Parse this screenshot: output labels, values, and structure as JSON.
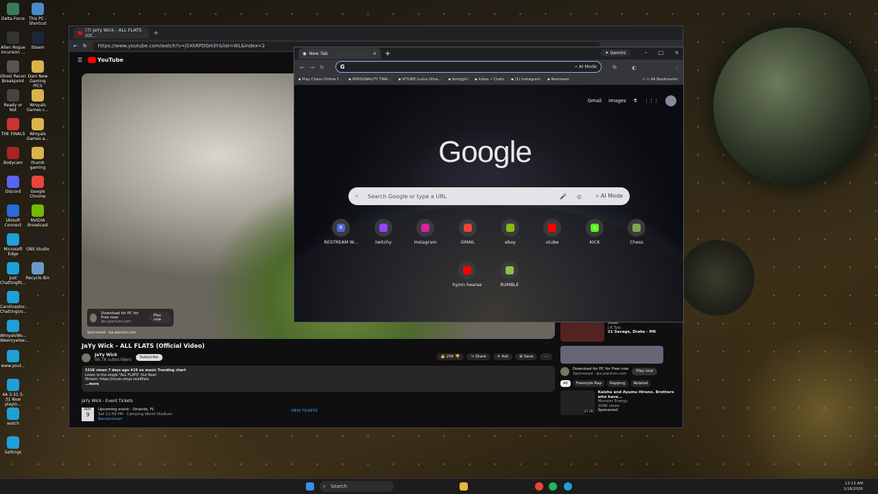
{
  "desktop": {
    "icons": [
      {
        "label": "Delta Force",
        "color": "#3a7a5a"
      },
      {
        "label": "This PC - Shortcut",
        "color": "#4a8ac8"
      },
      {
        "label": "Allen Rogue Incursion ...",
        "color": "#333"
      },
      {
        "label": "Steam",
        "color": "#1b2838"
      },
      {
        "label": "Ghost Recon Breakpoint",
        "color": "#555"
      },
      {
        "label": "Dani New Gaming PICS",
        "color": "#d8b44a"
      },
      {
        "label": "Ready or Not",
        "color": "#444"
      },
      {
        "label": "Wroyals Games c...",
        "color": "#d8b44a"
      },
      {
        "label": "THE FINALS",
        "color": "#c33"
      },
      {
        "label": "Wroyals Games a...",
        "color": "#d8b44a"
      },
      {
        "label": "Bodycam",
        "color": "#a22"
      },
      {
        "label": "thumb gaming",
        "color": "#d8b44a"
      },
      {
        "label": "Discord",
        "color": "#5865f2"
      },
      {
        "label": "Google Chrome",
        "color": "#e8453c"
      },
      {
        "label": "Ubisoft Connect",
        "color": "#2a6ad8"
      },
      {
        "label": "NVIDIA Broadcast",
        "color": "#76b900"
      },
      {
        "label": "Microsoft Edge",
        "color": "#1fa0d8"
      },
      {
        "label": "OBS Studio",
        "color": "#222"
      },
      {
        "label": "Just ChattingRt...",
        "color": "#1fa0d8"
      },
      {
        "label": "Recycle Bin",
        "color": "#6a9ac8"
      },
      {
        "label": "Carolinastor... ChattingUv...",
        "color": "#1fa0d8"
      },
      {
        "label": "WroyalsWo... Weeroyalsw...",
        "color": "#1fa0d8"
      },
      {
        "label": "www.yout...",
        "color": "#1fa0d8"
      },
      {
        "label": "4A 3-31 3-31 Now playin...",
        "color": "#1fa0d8"
      },
      {
        "label": "watch",
        "color": "#1fa0d8"
      },
      {
        "label": "Settings",
        "color": "#1fa0d8"
      }
    ]
  },
  "youtube_window": {
    "tab_title": "(7) JaYy Wick - ALL FLATS (Of...",
    "url": "https://www.youtube.com/watch?v=jSXkRPDGH3Y&list=WL&index=2",
    "logo": "YouTube",
    "ad": {
      "title": "Download for PC for Free now",
      "site": "lps.plarium.com",
      "button": "Play now",
      "sponsored": "Sponsored · lps.plarium.com"
    },
    "video_title": "JaYy Wick - ALL FLATS (Official Video)",
    "channel": "JaYy Wick",
    "subscribers": "99.7K subscribers",
    "subscribe": "Subscribe",
    "actions": {
      "likes": "25K",
      "share": "Share",
      "ask": "Ask",
      "save": "Save"
    },
    "desc_line1": "531K views  7 days ago  #19 on music Trending chart",
    "desc_line2": "Listen to the single \"ALL FLATS\" Out Now!",
    "desc_line3": "Stream: https://music.empi.re/allflats",
    "desc_more": "...more",
    "events_title": "JaYy Wick - Event Tickets",
    "event": {
      "month": "MAY",
      "day": "9",
      "title": "Upcoming event · Orlando, FL",
      "time": "Sat 11:59 PM · Camping World Stadium",
      "link": "Bandsintown",
      "cta": "VIEW TICKETS"
    },
    "side": {
      "item1": {
        "line1": "Video",
        "line2": "J.K.Tyju",
        "line3": "21 Savage, Drake - MR",
        "time": "4:51"
      },
      "ad": {
        "title": "Download for PC for Free now",
        "sponsored": "Sponsored · lps.plarium.com",
        "button": "Play now"
      },
      "chips": [
        "All",
        "Freestyle Rap",
        "Rapping",
        "Related"
      ],
      "item2": {
        "title": "Kaishu and Ayumu Hirano. Brothers who have...",
        "channel": "Monster Energy",
        "views": "209K views",
        "sponsored": "Sponsored",
        "time": "21:26"
      }
    }
  },
  "chrome_window": {
    "tab_title": "New Tab",
    "gemini": "Gemini",
    "ai_mode": "AI Mode",
    "bookmarks": [
      "Play Chess Online f...",
      "PERSONALITY TRAI...",
      "VITURE Luma Ultra...",
      "fentygirl",
      "Inbox • Chats",
      "(1) Instagram",
      "Restream"
    ],
    "all_bookmarks": "All Bookmarks",
    "gmail": "Gmail",
    "images": "Images",
    "logo": "Google",
    "search_placeholder": "Search Google or type a URL",
    "search_ai": "AI Mode",
    "shortcuts": [
      {
        "label": "RESTREAM W...",
        "color": "#4a6ad8",
        "letter": "R"
      },
      {
        "label": "twitchy",
        "color": "#9146ff",
        "letter": ""
      },
      {
        "label": "Instagram",
        "color": "#d6249f",
        "letter": ""
      },
      {
        "label": "GMAIL",
        "color": "#ea4335",
        "letter": ""
      },
      {
        "label": "ebay",
        "color": "#86b817",
        "letter": ""
      },
      {
        "label": "utube",
        "color": "#ff0000",
        "letter": ""
      },
      {
        "label": "KICK",
        "color": "#53fc18",
        "letter": "K"
      },
      {
        "label": "Chess",
        "color": "#7fa650",
        "letter": ""
      },
      {
        "label": "hymn hearse",
        "color": "#ff0000",
        "letter": ""
      },
      {
        "label": "RUMBLE",
        "color": "#85c742",
        "letter": ""
      }
    ]
  },
  "taskbar": {
    "search": "Search",
    "time": "12:13 AM",
    "date": "1/16/2026"
  }
}
